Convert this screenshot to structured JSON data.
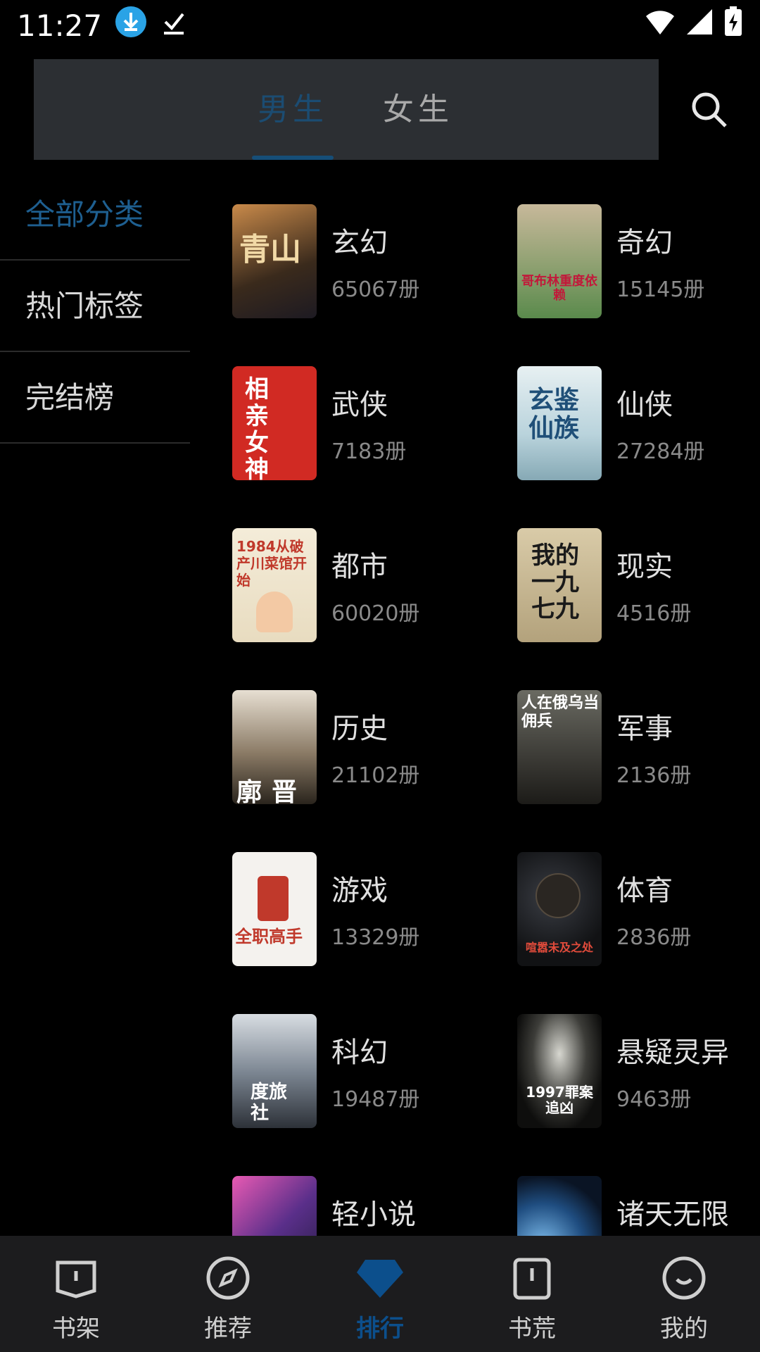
{
  "status_bar": {
    "time": "11:27",
    "icons": [
      "download-icon",
      "check-download-icon",
      "wifi-icon",
      "signal-icon",
      "battery-charging-icon"
    ]
  },
  "top_tabs": [
    {
      "label": "男生",
      "active": true
    },
    {
      "label": "女生",
      "active": false
    }
  ],
  "search": {
    "icon": "search-icon"
  },
  "sidebar": {
    "items": [
      {
        "label": "全部分类",
        "active": true
      },
      {
        "label": "热门标签",
        "active": false
      },
      {
        "label": "完结榜",
        "active": false
      }
    ]
  },
  "categories": [
    {
      "name": "玄幻",
      "count": "65067册",
      "cover_text": "青山"
    },
    {
      "name": "奇幻",
      "count": "15145册",
      "cover_text": "哥布林重度依赖"
    },
    {
      "name": "武侠",
      "count": "7183册",
      "cover_text": "相亲女神捕"
    },
    {
      "name": "仙侠",
      "count": "27284册",
      "cover_text": "玄鉴仙族"
    },
    {
      "name": "都市",
      "count": "60020册",
      "cover_text": "1984从破产川菜馆开始"
    },
    {
      "name": "现实",
      "count": "4516册",
      "cover_text": "我的一九七九"
    },
    {
      "name": "历史",
      "count": "21102册",
      "cover_text": "廓晋"
    },
    {
      "name": "军事",
      "count": "2136册",
      "cover_text": "人在俄乌当佣兵"
    },
    {
      "name": "游戏",
      "count": "13329册",
      "cover_text": "全职高手"
    },
    {
      "name": "体育",
      "count": "2836册",
      "cover_text": "喧嚣未及之处"
    },
    {
      "name": "科幻",
      "count": "19487册",
      "cover_text": "度旅社"
    },
    {
      "name": "悬疑灵异",
      "count": "9463册",
      "cover_text": "1997罪案追凶"
    },
    {
      "name": "轻小说",
      "count": "",
      "cover_text": ""
    },
    {
      "name": "诸天无限",
      "count": "",
      "cover_text": ""
    }
  ],
  "bottom_nav": [
    {
      "label": "书架",
      "icon": "bookshelf-icon",
      "active": false
    },
    {
      "label": "推荐",
      "icon": "compass-icon",
      "active": false
    },
    {
      "label": "排行",
      "icon": "ranking-diamond-icon",
      "active": true
    },
    {
      "label": "书荒",
      "icon": "book-alert-icon",
      "active": false
    },
    {
      "label": "我的",
      "icon": "smile-face-icon",
      "active": false
    }
  ],
  "colors": {
    "accent": "#0c4f8c",
    "background": "#000000",
    "topbar": "#2c2f33",
    "bottom_nav": "#1c1c1e"
  }
}
